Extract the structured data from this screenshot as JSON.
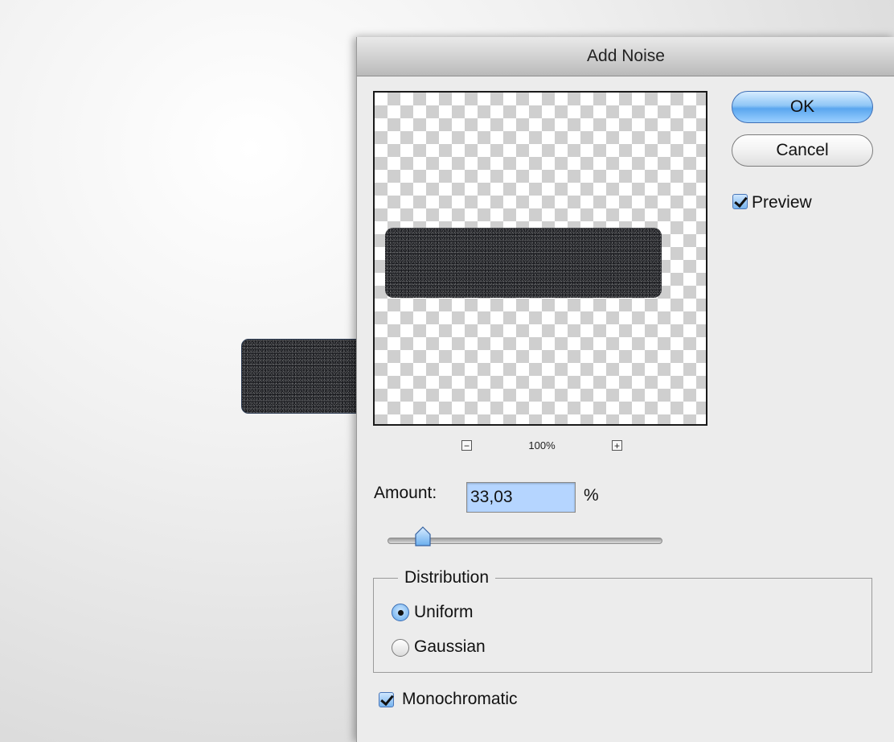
{
  "dialog": {
    "title": "Add Noise",
    "ok_label": "OK",
    "cancel_label": "Cancel",
    "preview": {
      "label": "Preview",
      "checked": true
    },
    "zoom": {
      "minus_label": "−",
      "level": "100%",
      "plus_label": "+"
    },
    "amount": {
      "label": "Amount:",
      "value": "33,03",
      "unit": "%",
      "slider_fraction": 0.08
    },
    "distribution": {
      "legend": "Distribution",
      "options": [
        {
          "label": "Uniform",
          "selected": true
        },
        {
          "label": "Gaussian",
          "selected": false
        }
      ]
    },
    "monochromatic": {
      "label": "Monochromatic",
      "checked": true
    }
  },
  "colors": {
    "ok_button_accent": "#5aa6ee",
    "noise_fill": "#1a1b1f",
    "checker_light": "#ffffff",
    "checker_dark": "#cfcfcf"
  }
}
